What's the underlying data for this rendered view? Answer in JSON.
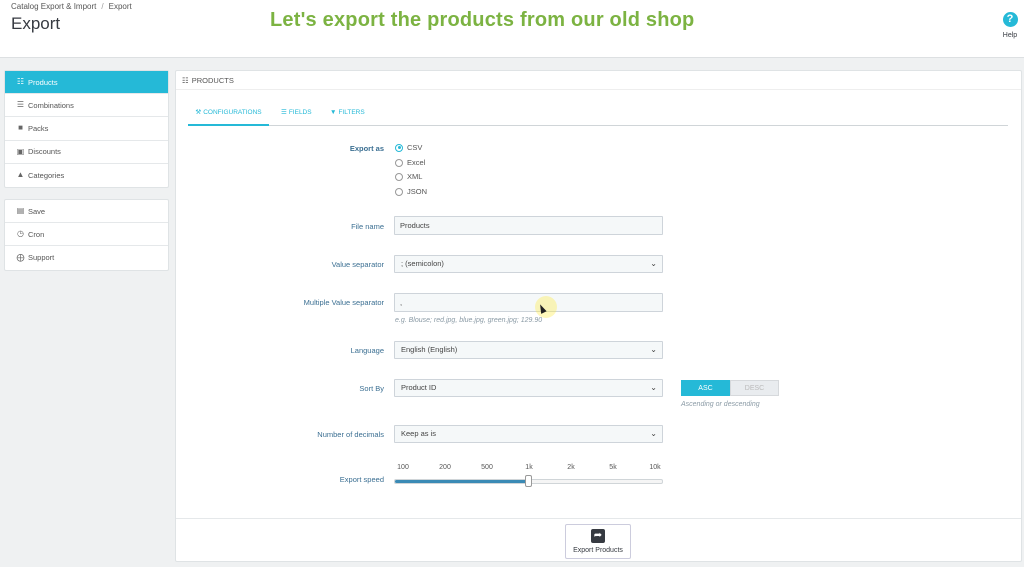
{
  "header": {
    "breadcrumb": [
      "Catalog Export & Import",
      "Export"
    ],
    "title": "Export",
    "caption": "Let's export the products from our old shop",
    "help": {
      "icon": "help-icon",
      "label": "Help"
    }
  },
  "menu_primary": [
    {
      "label": "Products",
      "icon": "products-icon",
      "active": true
    },
    {
      "label": "Combinations",
      "icon": "list-icon"
    },
    {
      "label": "Packs",
      "icon": "briefcase-icon"
    },
    {
      "label": "Discounts",
      "icon": "money-icon"
    },
    {
      "label": "Categories",
      "icon": "sitemap-icon"
    }
  ],
  "menu_secondary": [
    {
      "label": "Save",
      "icon": "save-icon"
    },
    {
      "label": "Cron",
      "icon": "clock-icon"
    },
    {
      "label": "Support",
      "icon": "lifebuoy-icon"
    }
  ],
  "panel": {
    "title": "Products",
    "tabs": [
      {
        "label": "Configurations",
        "icon": "wrench-icon",
        "active": true
      },
      {
        "label": "Fields",
        "icon": "sliders-icon"
      },
      {
        "label": "Filters",
        "icon": "filter-icon"
      }
    ]
  },
  "form": {
    "export_as": {
      "label": "Export as",
      "options": [
        "CSV",
        "Excel",
        "XML",
        "JSON"
      ],
      "selected": "CSV"
    },
    "file_name": {
      "label": "File name",
      "value": "Products"
    },
    "value_separator": {
      "label": "Value separator",
      "value": "; (semicolon)"
    },
    "multiple_value_separator": {
      "label": "Multiple Value separator",
      "value": ",",
      "hint": "e.g. Blouse; red.jpg, blue.jpg, green.jpg; 129.90"
    },
    "language": {
      "label": "Language",
      "value": "English (English)"
    },
    "sort_by": {
      "label": "Sort By",
      "value": "Product ID",
      "asc": "ASC",
      "desc": "DESC",
      "direction": "ASC",
      "hint": "Ascending or descending"
    },
    "decimals": {
      "label": "Number of decimals",
      "value": "Keep as is"
    },
    "export_speed": {
      "label": "Export speed",
      "ticks": [
        "100",
        "200",
        "500",
        "1k",
        "2k",
        "5k",
        "10k"
      ],
      "value": "1k",
      "position_fraction": 0.5
    }
  },
  "export_button": {
    "label": "Export Products",
    "icon": "share-icon"
  },
  "colors": {
    "accent": "#25b9d7",
    "caption": "#7cb342",
    "label": "#3b6f92",
    "slider": "#3a8ab5"
  }
}
